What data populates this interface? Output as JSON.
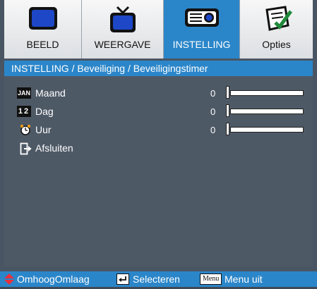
{
  "tabs": [
    {
      "label": "BEELD",
      "icon": "monitor-icon",
      "active": false
    },
    {
      "label": "WEERGAVE",
      "icon": "tv-icon",
      "active": false
    },
    {
      "label": "INSTELLING",
      "icon": "projector-icon",
      "active": true
    },
    {
      "label": "Opties",
      "icon": "checklist-icon",
      "active": false
    }
  ],
  "breadcrumb": "INSTELLING / Beveiliging / Beveiligingstimer",
  "rows": [
    {
      "icon_text": "JAN",
      "label": "Maand",
      "value": "0",
      "level": 0
    },
    {
      "icon_text": "12",
      "label": "Dag",
      "value": "0",
      "level": 0
    },
    {
      "icon_text": "",
      "label": "Uur",
      "value": "0",
      "level": 0
    },
    {
      "icon_text": "",
      "label": "Afsluiten"
    }
  ],
  "footer": {
    "nav_label": "OmhoogOmlaag",
    "select_label": "Selecteren",
    "menu_key": "Menu",
    "menu_label": "Menu uit"
  },
  "colors": {
    "accent": "#2b86c9",
    "panel": "#4e5966",
    "tab_bg": "#e9ecef"
  }
}
